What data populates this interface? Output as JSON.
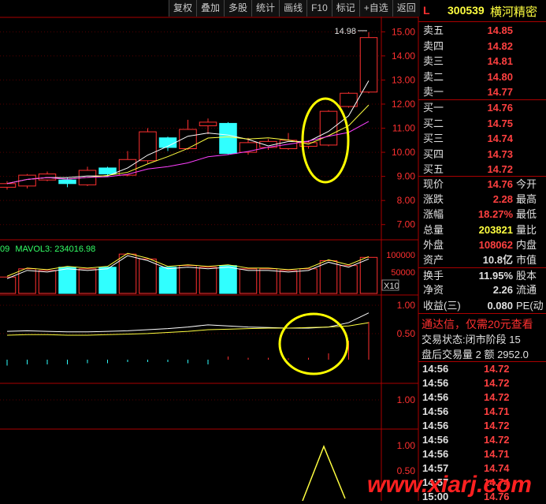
{
  "toolbar": [
    "复权",
    "叠加",
    "多股",
    "统计",
    "画线",
    "F10",
    "标记",
    "+自选",
    "返回"
  ],
  "header": {
    "flag": "L",
    "code": "300539",
    "name": "横河精密"
  },
  "sell_levels": [
    {
      "label": "卖五",
      "price": "14.85"
    },
    {
      "label": "卖四",
      "price": "14.82"
    },
    {
      "label": "卖三",
      "price": "14.81"
    },
    {
      "label": "卖二",
      "price": "14.80"
    },
    {
      "label": "卖一",
      "price": "14.77"
    }
  ],
  "buy_levels": [
    {
      "label": "买一",
      "price": "14.76"
    },
    {
      "label": "买二",
      "price": "14.75"
    },
    {
      "label": "买三",
      "price": "14.74"
    },
    {
      "label": "买四",
      "price": "14.73"
    },
    {
      "label": "买五",
      "price": "14.72"
    }
  ],
  "stats": [
    {
      "label": "现价",
      "value": "14.76",
      "label2": "今开",
      "color": "#ff4040"
    },
    {
      "label": "涨跌",
      "value": "2.28",
      "label2": "最高",
      "color": "#ff4040"
    },
    {
      "label": "涨幅",
      "value": "18.27%",
      "label2": "最低",
      "color": "#ff4040"
    },
    {
      "label": "总量",
      "value": "203821",
      "label2": "量比",
      "color": "#ffff40"
    },
    {
      "label": "外盘",
      "value": "108062",
      "label2": "内盘",
      "color": "#ff4040"
    },
    {
      "label": "资产",
      "value": "10.8亿",
      "label2": "市值",
      "color": "#e0e0e0"
    },
    {
      "label": "换手",
      "value": "11.95%",
      "label2": "股本",
      "color": "#e0e0e0"
    },
    {
      "label": "净资",
      "value": "2.26",
      "label2": "流通",
      "color": "#e0e0e0"
    },
    {
      "label": "收益(三)",
      "value": "0.080",
      "label2": "PE(动",
      "color": "#e0e0e0"
    }
  ],
  "ad_text": "通达信，仅需20元查看",
  "trade_status": "交易状态:闭市阶段 15",
  "after_hours": "盘后交易量 2 额 2952.0",
  "ticks": [
    {
      "time": "14:56",
      "price": "14.72"
    },
    {
      "time": "14:56",
      "price": "14.72"
    },
    {
      "time": "14:56",
      "price": "14.72"
    },
    {
      "time": "14:56",
      "price": "14.71"
    },
    {
      "time": "14:56",
      "price": "14.72"
    },
    {
      "time": "14:56",
      "price": "14.72"
    },
    {
      "time": "14:56",
      "price": "14.71"
    },
    {
      "time": "14:57",
      "price": "14.74"
    },
    {
      "time": "14:57",
      "price": "14.74"
    },
    {
      "time": "15:00",
      "price": "14.76"
    }
  ],
  "price_axis": [
    "15.00",
    "14.00",
    "13.00",
    "12.00",
    "11.00",
    "10.00",
    "9.00",
    "8.00",
    "7.00"
  ],
  "high_annotation": "14.98",
  "volume_label": "MAVOL3: 234016.98",
  "volume_label_prefix": "09",
  "volume_axis": [
    "100000",
    "50000"
  ],
  "volume_unit": "X10",
  "indicator_axis": [
    "1.00",
    "0.50"
  ],
  "panel3_axis": [
    "1.00"
  ],
  "panel4_axis": [
    "1.00",
    "0.50"
  ],
  "watermark": "www.xiarj.com",
  "colors": {
    "up": "#ff3030",
    "down": "#30ffff",
    "ma1": "#ffffff",
    "ma2": "#ffff40",
    "ma3": "#ff40ff",
    "highlight": "#ffff00"
  },
  "chart_data": {
    "type": "candlestick",
    "price_range": [
      6.5,
      15.6
    ],
    "candles": [
      {
        "o": 8.55,
        "c": 8.7,
        "h": 8.8,
        "l": 8.45
      },
      {
        "o": 8.6,
        "c": 9.05,
        "h": 9.1,
        "l": 8.5
      },
      {
        "o": 8.85,
        "c": 9.1,
        "h": 9.2,
        "l": 8.8
      },
      {
        "o": 8.85,
        "c": 8.7,
        "h": 8.95,
        "l": 8.55
      },
      {
        "o": 8.65,
        "c": 9.25,
        "h": 9.4,
        "l": 8.6
      },
      {
        "o": 9.35,
        "c": 9.1,
        "h": 9.4,
        "l": 9.05
      },
      {
        "o": 9.05,
        "c": 9.7,
        "h": 10.05,
        "l": 9.0
      },
      {
        "o": 9.65,
        "c": 10.85,
        "h": 11.0,
        "l": 9.55
      },
      {
        "o": 10.6,
        "c": 10.2,
        "h": 10.65,
        "l": 10.05
      },
      {
        "o": 10.15,
        "c": 10.95,
        "h": 11.35,
        "l": 10.1
      },
      {
        "o": 11.1,
        "c": 11.25,
        "h": 11.4,
        "l": 10.75
      },
      {
        "o": 11.2,
        "c": 9.95,
        "h": 11.25,
        "l": 9.9
      },
      {
        "o": 10.0,
        "c": 10.4,
        "h": 10.6,
        "l": 9.9
      },
      {
        "o": 10.2,
        "c": 10.45,
        "h": 10.55,
        "l": 10.1
      },
      {
        "o": 10.15,
        "c": 10.5,
        "h": 10.8,
        "l": 10.1
      },
      {
        "o": 10.25,
        "c": 10.4,
        "h": 10.5,
        "l": 10.15
      },
      {
        "o": 10.3,
        "c": 11.7,
        "h": 11.75,
        "l": 10.25
      },
      {
        "o": 11.9,
        "c": 12.45,
        "h": 12.5,
        "l": 11.85
      },
      {
        "o": 12.5,
        "c": 14.76,
        "h": 14.98,
        "l": 12.45
      }
    ],
    "volumes": [
      1.0,
      1.5,
      1.4,
      1.6,
      1.5,
      1.6,
      2.4,
      2.1,
      1.6,
      1.7,
      1.6,
      1.7,
      1.5,
      1.5,
      1.4,
      1.5,
      2.0,
      1.7,
      2.2
    ],
    "volume_up": [
      true,
      true,
      true,
      false,
      true,
      false,
      true,
      true,
      false,
      true,
      true,
      false,
      true,
      true,
      true,
      true,
      true,
      true,
      true
    ]
  }
}
